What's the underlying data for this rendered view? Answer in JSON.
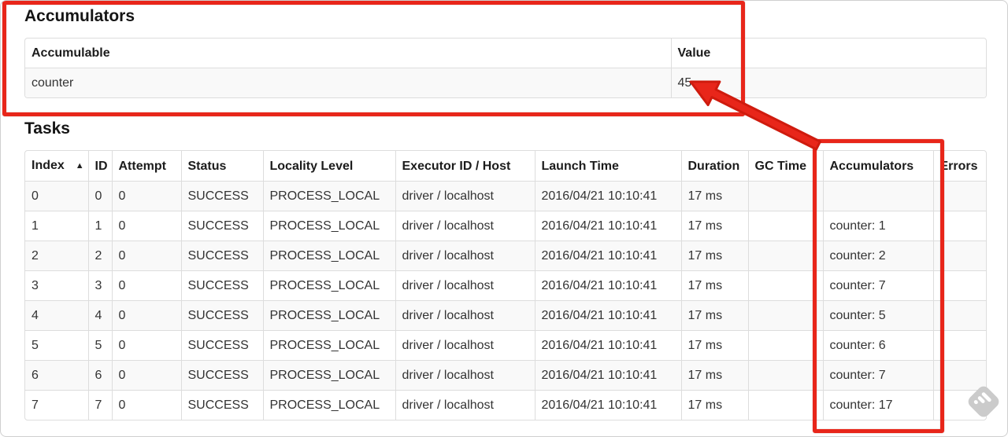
{
  "accumulators_section": {
    "title": "Accumulators",
    "table": {
      "headers": [
        "Accumulable",
        "Value"
      ],
      "rows": [
        [
          "counter",
          "45"
        ]
      ]
    }
  },
  "tasks_section": {
    "title": "Tasks",
    "table": {
      "headers": [
        "Index",
        "ID",
        "Attempt",
        "Status",
        "Locality Level",
        "Executor ID / Host",
        "Launch Time",
        "Duration",
        "GC Time",
        "Accumulators",
        "Errors"
      ],
      "sort": {
        "column": "Index",
        "direction": "ascending",
        "icon": "▲"
      },
      "rows": [
        [
          "0",
          "0",
          "0",
          "SUCCESS",
          "PROCESS_LOCAL",
          "driver / localhost",
          "2016/04/21 10:10:41",
          "17 ms",
          "",
          "",
          ""
        ],
        [
          "1",
          "1",
          "0",
          "SUCCESS",
          "PROCESS_LOCAL",
          "driver / localhost",
          "2016/04/21 10:10:41",
          "17 ms",
          "",
          "counter: 1",
          ""
        ],
        [
          "2",
          "2",
          "0",
          "SUCCESS",
          "PROCESS_LOCAL",
          "driver / localhost",
          "2016/04/21 10:10:41",
          "17 ms",
          "",
          "counter: 2",
          ""
        ],
        [
          "3",
          "3",
          "0",
          "SUCCESS",
          "PROCESS_LOCAL",
          "driver / localhost",
          "2016/04/21 10:10:41",
          "17 ms",
          "",
          "counter: 7",
          ""
        ],
        [
          "4",
          "4",
          "0",
          "SUCCESS",
          "PROCESS_LOCAL",
          "driver / localhost",
          "2016/04/21 10:10:41",
          "17 ms",
          "",
          "counter: 5",
          ""
        ],
        [
          "5",
          "5",
          "0",
          "SUCCESS",
          "PROCESS_LOCAL",
          "driver / localhost",
          "2016/04/21 10:10:41",
          "17 ms",
          "",
          "counter: 6",
          ""
        ],
        [
          "6",
          "6",
          "0",
          "SUCCESS",
          "PROCESS_LOCAL",
          "driver / localhost",
          "2016/04/21 10:10:41",
          "17 ms",
          "",
          "counter: 7",
          ""
        ],
        [
          "7",
          "7",
          "0",
          "SUCCESS",
          "PROCESS_LOCAL",
          "driver / localhost",
          "2016/04/21 10:10:41",
          "17 ms",
          "",
          "counter: 17",
          ""
        ]
      ]
    }
  },
  "annotations": {
    "highlight_color": "#e8261a",
    "boxes": [
      {
        "purpose": "highlight accumulators summary section"
      },
      {
        "purpose": "highlight per-task Accumulators column"
      }
    ],
    "arrow": {
      "from": "Accumulators column highlight",
      "to": "total value 45"
    }
  },
  "watermark": {
    "icon": "feedly-logo",
    "color": "#cbcbcb"
  }
}
